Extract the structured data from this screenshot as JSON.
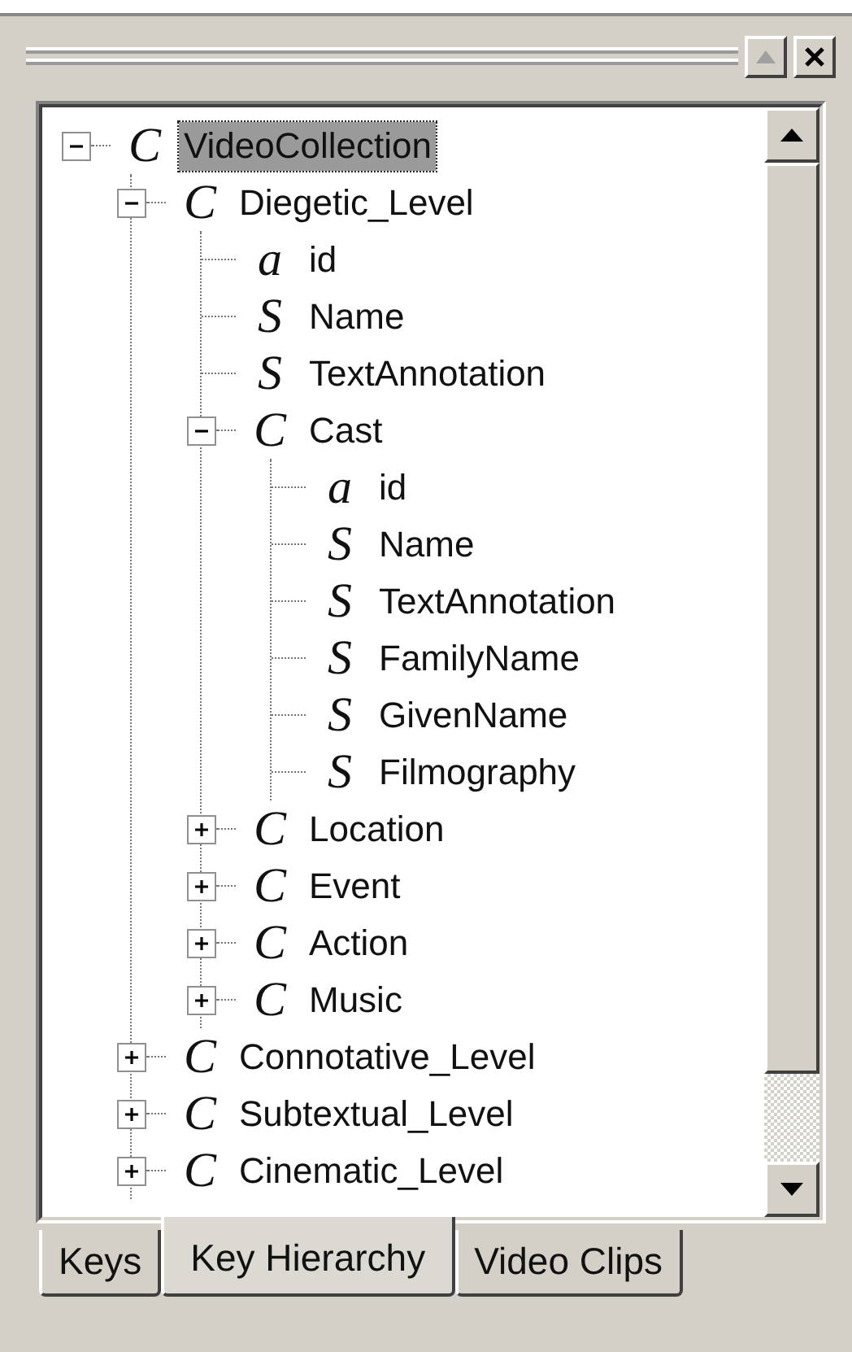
{
  "tree": [
    {
      "glyph": "C",
      "label": "VideoCollection",
      "selected": true,
      "expanded": true,
      "children": [
        {
          "glyph": "C",
          "label": "Diegetic_Level",
          "selected": false,
          "expanded": true,
          "children": [
            {
              "glyph": "a",
              "label": "id",
              "selected": false
            },
            {
              "glyph": "S",
              "label": "Name",
              "selected": false
            },
            {
              "glyph": "S",
              "label": "TextAnnotation",
              "selected": false
            },
            {
              "glyph": "C",
              "label": "Cast",
              "selected": false,
              "expanded": true,
              "children": [
                {
                  "glyph": "a",
                  "label": "id",
                  "selected": false
                },
                {
                  "glyph": "S",
                  "label": "Name",
                  "selected": false
                },
                {
                  "glyph": "S",
                  "label": "TextAnnotation",
                  "selected": false
                },
                {
                  "glyph": "S",
                  "label": "FamilyName",
                  "selected": false
                },
                {
                  "glyph": "S",
                  "label": "GivenName",
                  "selected": false
                },
                {
                  "glyph": "S",
                  "label": "Filmography",
                  "selected": false
                }
              ]
            },
            {
              "glyph": "C",
              "label": "Location",
              "selected": false,
              "expanded": false
            },
            {
              "glyph": "C",
              "label": "Event",
              "selected": false,
              "expanded": false
            },
            {
              "glyph": "C",
              "label": "Action",
              "selected": false,
              "expanded": false
            },
            {
              "glyph": "C",
              "label": "Music",
              "selected": false,
              "expanded": false
            }
          ]
        },
        {
          "glyph": "C",
          "label": "Connotative_Level",
          "selected": false,
          "expanded": false
        },
        {
          "glyph": "C",
          "label": "Subtextual_Level",
          "selected": false,
          "expanded": false
        },
        {
          "glyph": "C",
          "label": "Cinematic_Level",
          "selected": false,
          "expanded": false
        }
      ]
    }
  ],
  "tabs": [
    {
      "label": "Keys",
      "selected": false
    },
    {
      "label": "Key Hierarchy",
      "selected": true
    },
    {
      "label": "Video Clips",
      "selected": false
    }
  ]
}
